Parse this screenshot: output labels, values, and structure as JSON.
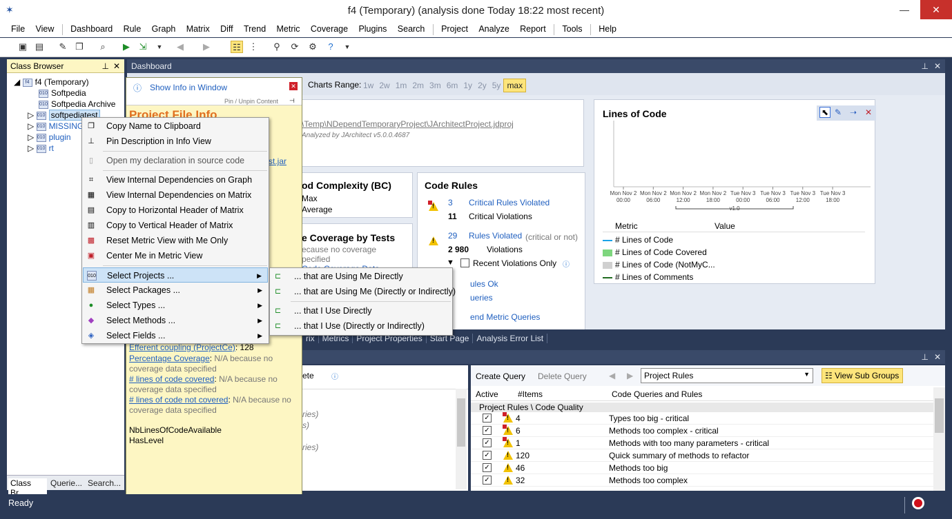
{
  "window": {
    "title": "f4 (Temporary)  (analysis done Today 18:22 most recent)",
    "min": "—",
    "max": "☐",
    "close": "✕"
  },
  "menu": [
    "File",
    "View",
    "Dashboard",
    "Rule",
    "Graph",
    "Matrix",
    "Diff",
    "Trend",
    "Metric",
    "Coverage",
    "Plugins",
    "Search",
    "Project",
    "Analyze",
    "Report",
    "Tools",
    "Help"
  ],
  "class_browser": {
    "title": "Class Browser",
    "root": "f4 (Temporary)",
    "items": [
      "Softpedia",
      "Softpedia Archive",
      "softpediatest",
      "MISSING",
      "plugin",
      "rt"
    ],
    "tabs": [
      "Class Br...",
      "Querie...",
      "Search..."
    ]
  },
  "info_panel": {
    "show_info": "Show Info in Window",
    "pin": "Pin / Unpin Content",
    "heading": "Project File Info",
    "jar_suffix": "st.jar",
    "efferent": "Efferent coupling (ProjectCe)",
    "efferent_val": "128",
    "pct_cov": "Percentage Coverage",
    "na_cov": "N/A because no coverage data specified",
    "loc_covered": "# lines of code covered",
    "loc_not_covered": "# lines of code not covered",
    "nb_lines": "NbLinesOfCodeAvailable",
    "has_level": "HasLevel"
  },
  "context_menu": [
    {
      "label": "Copy Name to Clipboard",
      "icon": "copy-icon"
    },
    {
      "label": "Pin Description in Info View",
      "icon": "pin-icon"
    },
    {
      "label": "Open my declaration in source code",
      "icon": "document-icon"
    },
    {
      "label": "View Internal Dependencies on Graph",
      "icon": "graph-icon"
    },
    {
      "label": "View Internal Dependencies on Matrix",
      "icon": "matrix-icon"
    },
    {
      "label": "Copy to Horizontal Header of Matrix",
      "icon": "matrix-h-icon"
    },
    {
      "label": "Copy to Vertical Header of Matrix",
      "icon": "matrix-v-icon"
    },
    {
      "label": "Reset Metric View with Me Only",
      "icon": "metric-icon"
    },
    {
      "label": "Center Me in Metric View",
      "icon": "center-icon"
    },
    {
      "label": "Select Projects ...",
      "icon": "project-icon"
    },
    {
      "label": "Select Packages ...",
      "icon": "package-icon"
    },
    {
      "label": "Select Types ...",
      "icon": "type-icon"
    },
    {
      "label": "Select Methods ...",
      "icon": "method-icon"
    },
    {
      "label": "Select Fields ...",
      "icon": "field-icon"
    }
  ],
  "submenu": [
    "... that are Using Me Directly",
    "... that are Using Me (Directly or Indirectly)",
    "... that I Use Directly",
    "... that I Use (Directly or Indirectly)"
  ],
  "dashboard": {
    "title": "Dashboard",
    "charts_range": "Charts Range:",
    "ranges": [
      "1w",
      "2w",
      "1m",
      "2m",
      "3m",
      "6m",
      "1y",
      "2y",
      "5y",
      "max"
    ],
    "project_path": "\\Temp\\NDependTemporaryProject\\JArchitectProject.jdproj",
    "analyzed_by": "Analyzed by JArchitect v5.0.0.4687",
    "complexity_title": "od Complexity (BC)",
    "complexity_max": "Max",
    "complexity_avg": "Average",
    "coverage_title": "e Coverage by Tests",
    "coverage_na1": "ecause no coverage",
    "coverage_na2": "pecified",
    "coverage_link": "Code Coverage Data",
    "code_rules_title": "Code Rules",
    "crit_violated_n": "3",
    "crit_violated": "Critical Rules Violated",
    "crit_viol_n": "11",
    "crit_viol": "Critical Violations",
    "rules_violated_n": "29",
    "rules_violated": "Rules Violated",
    "violations_n": "2 980",
    "violations": "Violations",
    "crit_or_not": "(critical or not)",
    "recent_only": "Recent Violations Only",
    "rules_ok": "ules Ok",
    "queries": "ueries",
    "trend_queries": "end Metric Queries",
    "loc_title": "Lines of Code",
    "x_ticks": [
      [
        "Mon Nov 2",
        "00:00"
      ],
      [
        "Mon Nov 2",
        "06:00"
      ],
      [
        "Mon Nov 2",
        "12:00"
      ],
      [
        "Mon Nov 2",
        "18:00"
      ],
      [
        "Tue Nov 3",
        "00:00"
      ],
      [
        "Tue Nov 3",
        "06:00"
      ],
      [
        "Tue Nov 3",
        "12:00"
      ],
      [
        "Tue Nov 3",
        "18:00"
      ]
    ],
    "baseline": "v1.0",
    "legend_head": [
      "Metric",
      "Value"
    ],
    "legend": [
      {
        "name": "# Lines of Code",
        "color": "#1aa3e8",
        "kind": "line"
      },
      {
        "name": "# Lines of Code Covered",
        "color": "#7ed67e",
        "kind": "box"
      },
      {
        "name": "# Lines of Code (NotMyC...",
        "color": "#d0d0d0",
        "kind": "box"
      },
      {
        "name": "# Lines of Comments",
        "color": "#1f6b1f",
        "kind": "line"
      }
    ]
  },
  "bottom_tabs": [
    "rix",
    "Metrics",
    "Project Properties",
    "Start Page",
    "Analysis Error List"
  ],
  "query_panel": {
    "delete_frag": "ete",
    "create": "Create Query",
    "delete": "Delete Query",
    "group": "Project Rules",
    "view_sub": "View Sub Groups",
    "cols": [
      "Active",
      "#Items",
      "Code Queries and Rules"
    ],
    "group_row": "Project Rules \\ Code Quality",
    "rows": [
      {
        "items": "4",
        "name": "Types too big - critical",
        "crit": true
      },
      {
        "items": "6",
        "name": "Methods too complex - critical",
        "crit": true
      },
      {
        "items": "1",
        "name": "Methods with too many parameters - critical",
        "crit": true
      },
      {
        "items": "120",
        "name": "Quick summary of methods to refactor",
        "crit": false
      },
      {
        "items": "46",
        "name": "Methods too big",
        "crit": false
      },
      {
        "items": "32",
        "name": "Methods too complex",
        "crit": false
      }
    ],
    "left_frags": [
      "ries)",
      "s)",
      "ries)"
    ]
  },
  "status": "Ready"
}
